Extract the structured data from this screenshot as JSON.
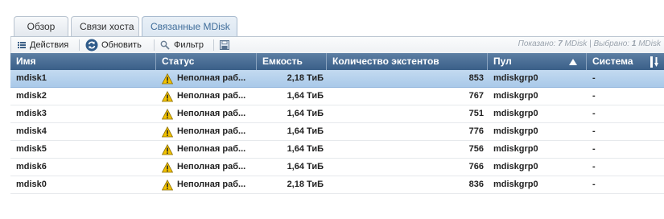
{
  "tabs": [
    {
      "label": "Обзор"
    },
    {
      "label": "Связи хоста"
    },
    {
      "label": "Связанные MDisk"
    }
  ],
  "toolbar": {
    "actions_label": "Действия",
    "refresh_label": "Обновить",
    "filter_label": "Фильтр",
    "shown_prefix": "Показано: ",
    "shown_count": "7",
    "shown_unit": " MDisk",
    "separator": " | ",
    "selected_prefix": "Выбрано: ",
    "selected_count": "1",
    "selected_unit": " MDisk"
  },
  "table": {
    "columns": [
      "Имя",
      "Статус",
      "Емкость",
      "Количество экстентов",
      "Пул",
      "Система"
    ],
    "rows": [
      {
        "name": "mdisk1",
        "status": "Неполная раб...",
        "capacity": "2,18 ТиБ",
        "extents": "853",
        "pool": "mdiskgrp0",
        "system": "-",
        "selected": true
      },
      {
        "name": "mdisk2",
        "status": "Неполная раб...",
        "capacity": "1,64 ТиБ",
        "extents": "767",
        "pool": "mdiskgrp0",
        "system": "-",
        "selected": false
      },
      {
        "name": "mdisk3",
        "status": "Неполная раб...",
        "capacity": "1,64 ТиБ",
        "extents": "751",
        "pool": "mdiskgrp0",
        "system": "-",
        "selected": false
      },
      {
        "name": "mdisk4",
        "status": "Неполная раб...",
        "capacity": "1,64 ТиБ",
        "extents": "776",
        "pool": "mdiskgrp0",
        "system": "-",
        "selected": false
      },
      {
        "name": "mdisk5",
        "status": "Неполная раб...",
        "capacity": "1,64 ТиБ",
        "extents": "756",
        "pool": "mdiskgrp0",
        "system": "-",
        "selected": false
      },
      {
        "name": "mdisk6",
        "status": "Неполная раб...",
        "capacity": "1,64 ТиБ",
        "extents": "766",
        "pool": "mdiskgrp0",
        "system": "-",
        "selected": false
      },
      {
        "name": "mdisk0",
        "status": "Неполная раб...",
        "capacity": "2,18 ТиБ",
        "extents": "836",
        "pool": "mdiskgrp0",
        "system": "-",
        "selected": false
      }
    ]
  },
  "icons": {
    "actions": "list-icon",
    "refresh": "refresh-icon",
    "filter": "magnifier-icon",
    "export": "save-icon",
    "status": "warning-icon",
    "sort_pool": "sort-ascending-icon",
    "sort_system": "column-sort-icon"
  },
  "colors": {
    "header_bg": "#3a5f88",
    "selected_row": "#b3d0ec",
    "active_tab_text": "#3f6d9a",
    "warning": "#f2c200"
  }
}
